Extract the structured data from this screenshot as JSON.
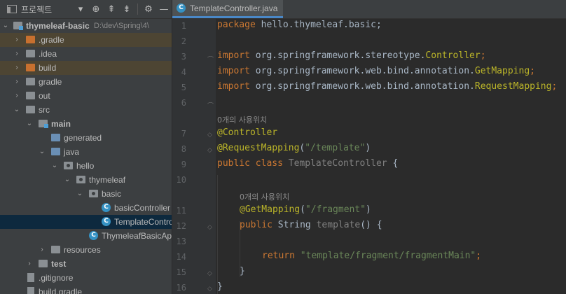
{
  "project_panel": {
    "title": "프로젝트",
    "toolbar": {
      "dropdown_icon": "chevron-down-icon",
      "locate_icon": "crosshair-icon",
      "expand_icon": "expand-all-icon",
      "collapse_icon": "collapse-all-icon",
      "settings_icon": "gear-icon",
      "hide_icon": "minus-icon"
    },
    "tree": [
      {
        "label": "thymeleaf-basic",
        "path": "D:\\dev\\Spring\\4\\",
        "bold": true
      },
      {
        "label": ".gradle"
      },
      {
        "label": ".idea"
      },
      {
        "label": "build"
      },
      {
        "label": "gradle"
      },
      {
        "label": "out"
      },
      {
        "label": "src"
      },
      {
        "label": "main"
      },
      {
        "label": "generated"
      },
      {
        "label": "java"
      },
      {
        "label": "hello"
      },
      {
        "label": "thymeleaf"
      },
      {
        "label": "basic"
      },
      {
        "label": "basicController"
      },
      {
        "label": "TemplateController"
      },
      {
        "label": "ThymeleafBasicApplication"
      },
      {
        "label": "resources"
      },
      {
        "label": "test"
      },
      {
        "label": ".gitignore"
      },
      {
        "label": "build.gradle"
      }
    ]
  },
  "editor": {
    "tab": {
      "title": "TemplateController.java",
      "icon": "class-icon"
    },
    "line_numbers": [
      "1",
      "2",
      "3",
      "4",
      "5",
      "6",
      "7",
      "8",
      "9",
      "10",
      "11",
      "12",
      "13",
      "14",
      "15",
      "16"
    ],
    "hints": [
      "0개의 사용위치",
      "0개의 사용위치"
    ],
    "code": {
      "l1": {
        "kw": "package",
        "rest": " hello.thymeleaf.basic;"
      },
      "l3": {
        "kw": "import",
        "pre": " org.springframework.stereotype.",
        "cls": "Controller",
        "end": ";"
      },
      "l4": {
        "kw": "import",
        "pre": " org.springframework.web.bind.annotation.",
        "cls": "GetMapping",
        "end": ";"
      },
      "l5": {
        "kw": "import",
        "pre": " org.springframework.web.bind.annotation.",
        "cls": "RequestMapping",
        "end": ";"
      },
      "l7": {
        "ann": "@Controller"
      },
      "l8": {
        "ann": "@RequestMapping",
        "open": "(",
        "str": "\"/template\"",
        "close": ")"
      },
      "l9": {
        "kw": "public class",
        "name": " TemplateController",
        "brace": " {"
      },
      "l11": {
        "ann": "@GetMapping",
        "open": "(",
        "str": "\"/fragment\"",
        "close": ")"
      },
      "l12": {
        "kw": "public",
        "type": " String ",
        "name": "template",
        "rest": "() {"
      },
      "l14": {
        "kw": "return",
        "str": " \"template/fragment/fragmentMain\"",
        "end": ";"
      },
      "l15": {
        "text": "}"
      },
      "l16": {
        "text": "}"
      }
    }
  },
  "colors": {
    "keyword": "#cc7832",
    "annotation": "#bbb529",
    "string": "#6a8759",
    "method": "#ffc66d",
    "text": "#a9b7c6",
    "background": "#2b2b2b",
    "panel": "#3c3f41",
    "selection": "#0d293e",
    "excluded": "#4d4533"
  }
}
